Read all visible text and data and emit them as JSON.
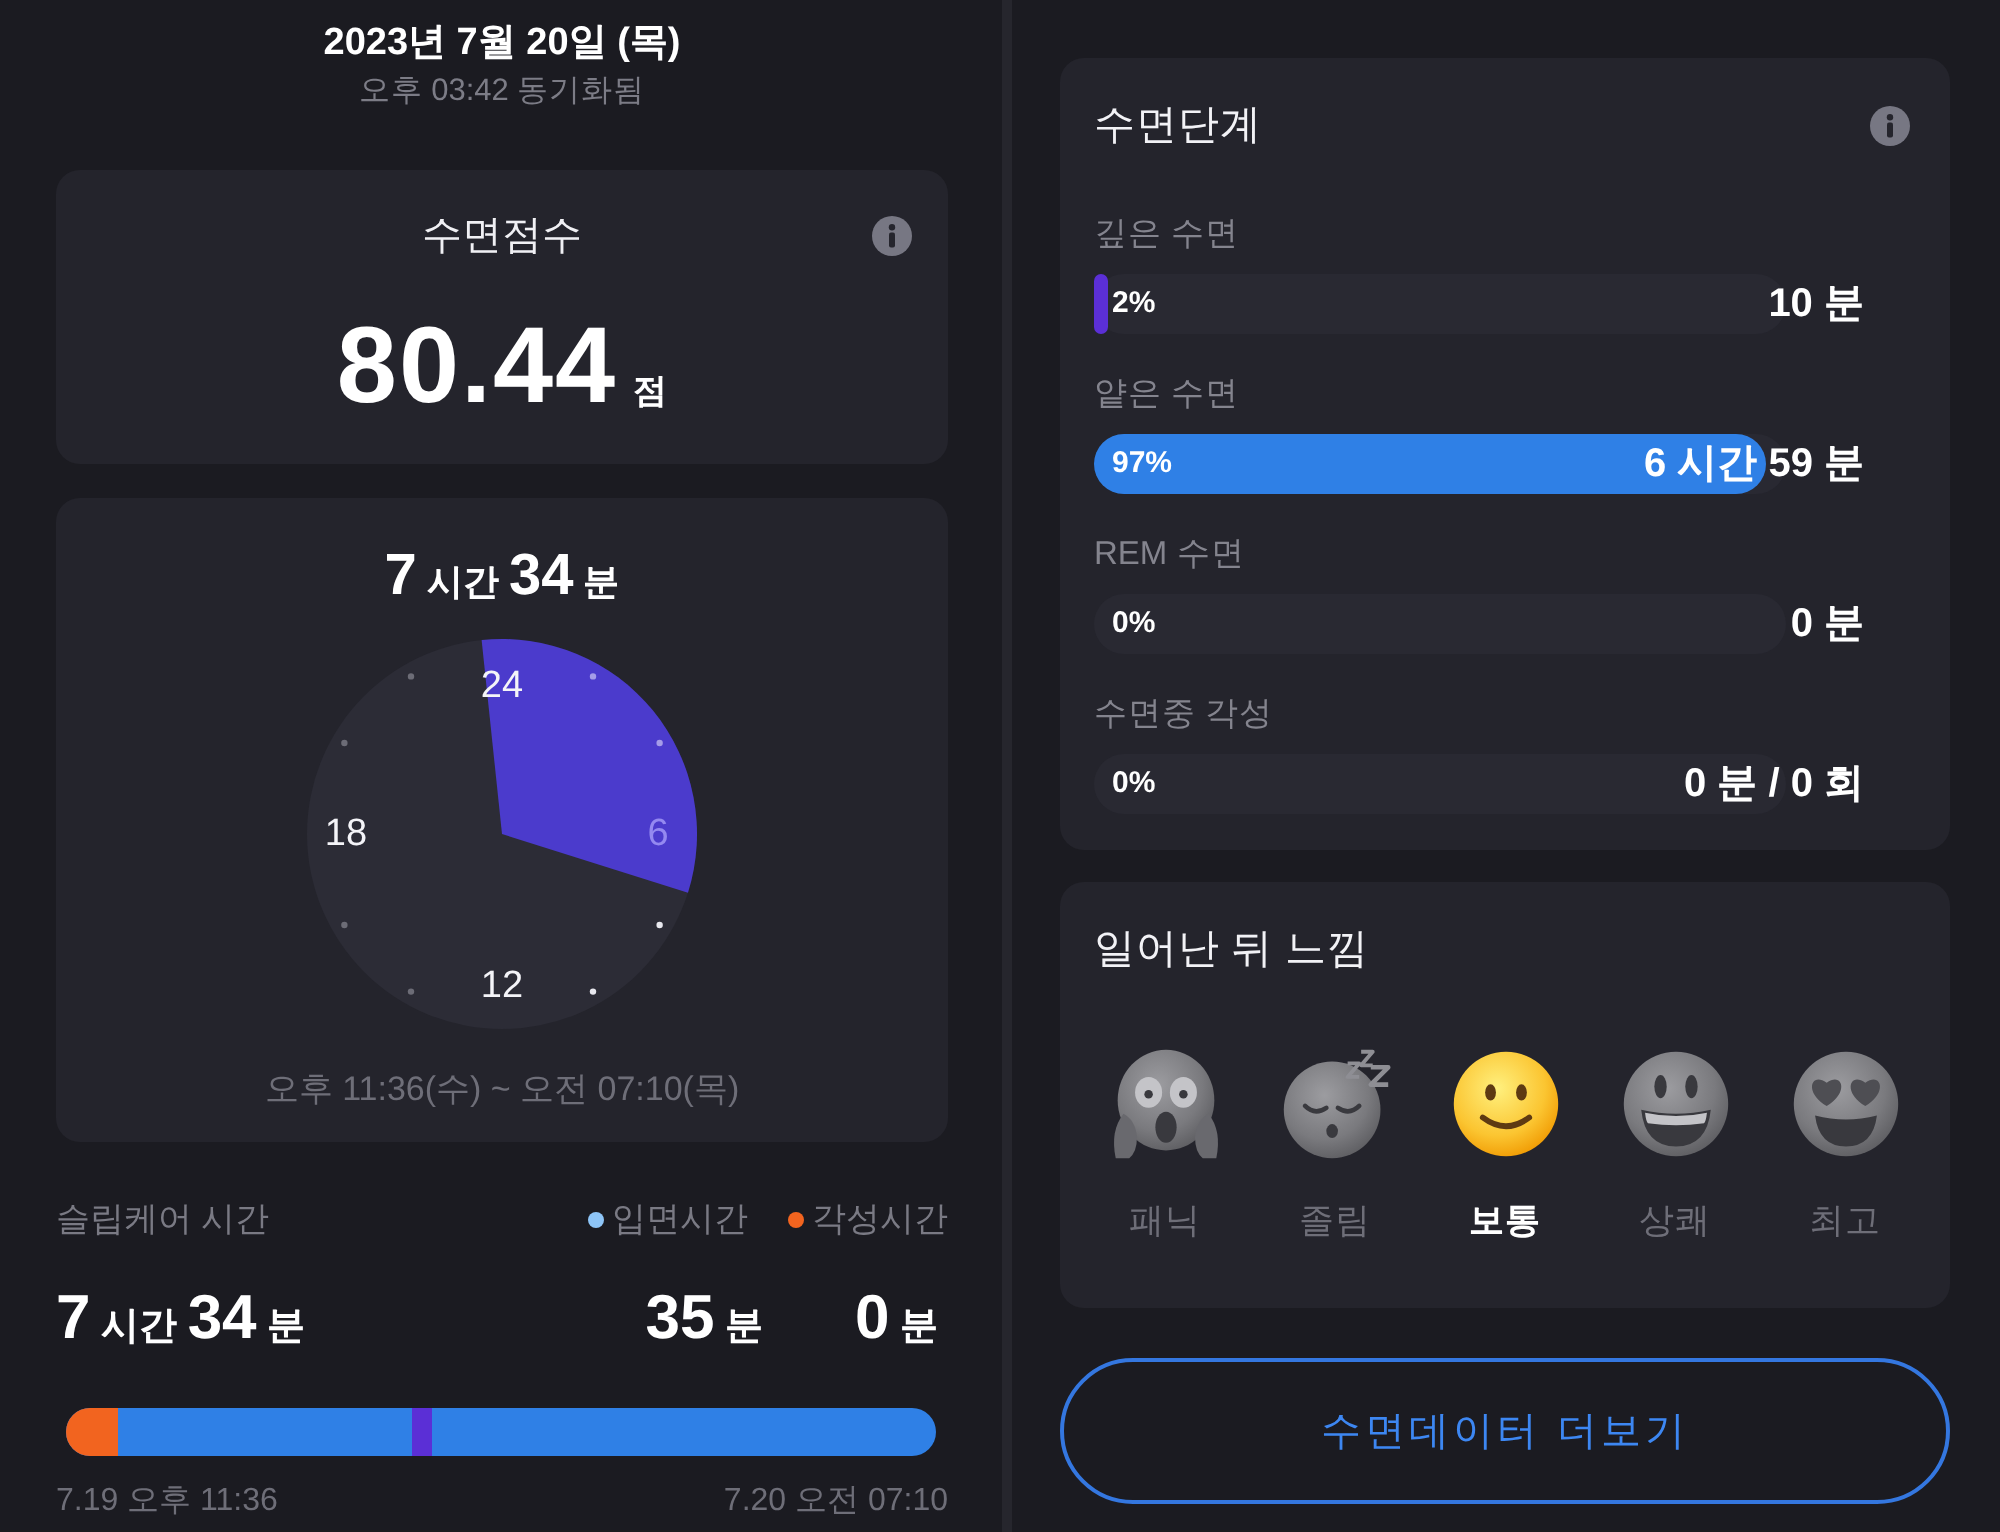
{
  "left_screen": {
    "header": {
      "date": "2023년 7월 20일 (목)",
      "sync_status": "오후 03:42 동기화됨"
    },
    "sleep_score_card": {
      "title": "수면점수",
      "score": "80.44",
      "unit": "점"
    },
    "sleep_time_card": {
      "duration": "**7** 시간 **34** 분",
      "clock_labels": [
        "24",
        "6",
        "12",
        "18"
      ],
      "range": "오후 11:36(수) ~ 오전 07:10(목)"
    },
    "sleep_care": {
      "title": "슬립케어 시간",
      "legend": [
        {
          "label": "입면시간",
          "color": "#8ec5f7"
        },
        {
          "label": "각성시간",
          "color": "#f2641f"
        }
      ],
      "total": "**7** 시간 **34** 분",
      "values": [
        "**35** 분",
        "**0** 분"
      ],
      "start": "7.19 오후 11:36",
      "end": "7.20 오전 07:10"
    }
  },
  "right_screen": {
    "sleep_stages": {
      "title": "수면단계",
      "stages": [
        {
          "label": "깊은 수면",
          "percent": "2%",
          "level": 0.02,
          "color": "#5b2fd6",
          "value": "10 분"
        },
        {
          "label": "얕은 수면",
          "percent": "97%",
          "level": 0.97,
          "color": "#2f80e6",
          "value": "6 시간 59 분"
        },
        {
          "label": "REM 수면",
          "percent": "0%",
          "value": "0 분"
        },
        {
          "label": "수면중 각성",
          "percent": "0%",
          "value": "0 분 / 0 회"
        }
      ]
    },
    "mood": {
      "title": "일어난 뒤 느낌",
      "options": [
        {
          "label": "패닉",
          "selected": false
        },
        {
          "label": "졸림",
          "selected": false
        },
        {
          "label": "보통",
          "selected": true
        },
        {
          "label": "상쾌",
          "selected": false
        },
        {
          "label": "최고",
          "selected": false
        }
      ]
    },
    "more_button": {
      "label": "수면데이터 더보기"
    }
  }
}
